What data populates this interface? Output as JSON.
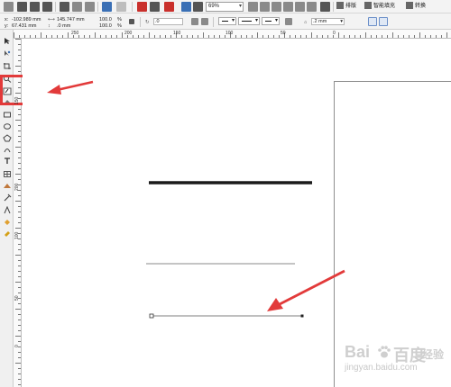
{
  "toolbar": {
    "zoom_value": "69%",
    "buttons": {
      "layout_label": "排版",
      "artistic_label": "智能填充",
      "convert_label": "转换"
    }
  },
  "property_bar": {
    "x_label": "x:",
    "x_value": "-102.989 mm",
    "y_label": "y:",
    "y_value": "67.431 mm",
    "w_value": "145.747 mm",
    "h_value": ".0 mm",
    "scale_x": "100.0",
    "scale_y": "100.0",
    "pct": "%",
    "rotation": ".0",
    "outline_width": ".2 mm"
  },
  "ruler": {
    "top_labels": [
      "250",
      "200",
      "150",
      "100",
      "50",
      "0"
    ],
    "left_labels": [
      "150",
      "200",
      "100",
      "50",
      "0"
    ]
  },
  "watermark": {
    "brand": "Bai",
    "brand2": "百度",
    "brand3": "经验",
    "sub": "jingyan.baidu.com"
  },
  "colors": {
    "annotation_red": "#e23a3a",
    "thick_line": "#1a1a1a",
    "thin_line": "#7a7a7a"
  }
}
